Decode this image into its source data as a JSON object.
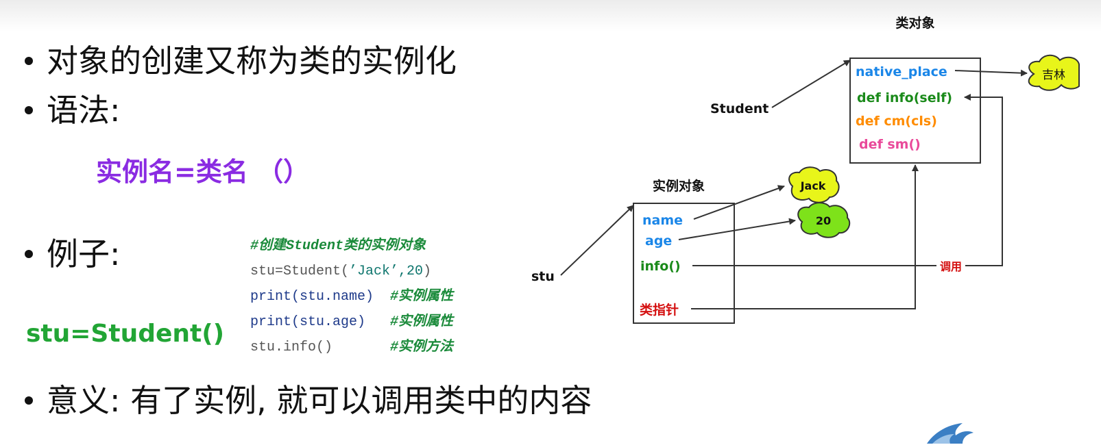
{
  "bullets": {
    "b1": "对象的创建又称为类的实例化",
    "b2": "语法:",
    "b3": "例子:",
    "b4": "意义:  有了实例, 就可以调用类中的内容"
  },
  "syntax_formula": "实例名=类名 （）",
  "example_big": "stu=Student()",
  "code": {
    "line1_comment": "#创建Student类的实例对象",
    "line2_prefix": "stu=Student(",
    "line2_args": "’Jack’,20",
    "line2_suffix": ")",
    "line3_code": "print(stu.name)",
    "line3_comment": "#实例属性",
    "line4_code": "print(stu.age)",
    "line4_comment": "#实例属性",
    "line5_code": "stu.info()",
    "line5_comment": "#实例方法"
  },
  "diagram": {
    "class_box_title": "类对象",
    "class_members": {
      "native_place": "native_place",
      "info": "def info(self)",
      "cm": "def cm(cls)",
      "sm": "def sm()"
    },
    "student_label": "Student",
    "jilin_cloud": "吉林",
    "instance_box_title": "实例对象",
    "instance_members": {
      "name": "name",
      "age": "age",
      "info": "info()",
      "class_pointer": "类指针"
    },
    "jack_cloud": "Jack",
    "age_cloud": "20",
    "stu_label": "stu",
    "call_label": "调用"
  },
  "colors": {
    "blue": "#1a86e8",
    "green": "#1a8a1a",
    "orange": "#ff8c00",
    "pink": "#e94a9a",
    "red": "#d41010",
    "cloud_fill": "#e8f51a",
    "cloud_green": "#7ee21a",
    "purple": "#8a2be2"
  }
}
